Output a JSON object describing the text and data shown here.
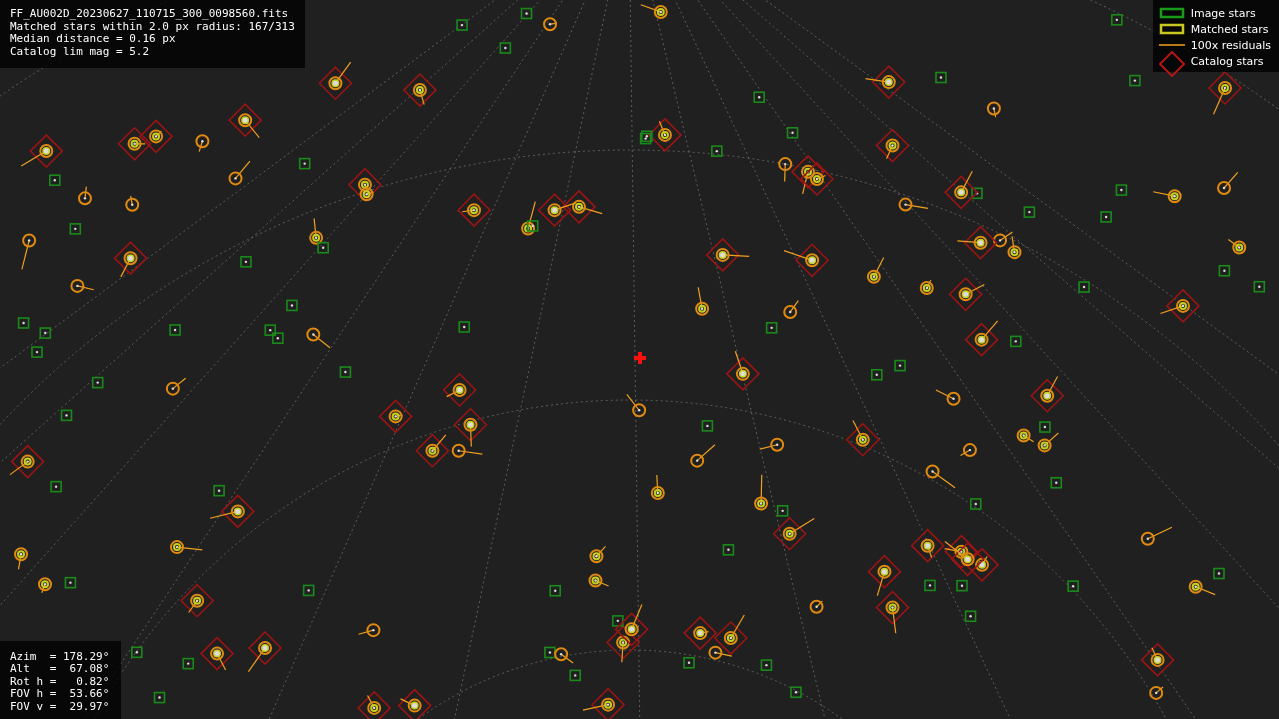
{
  "info": {
    "lines": [
      "FF_AU002D_20230627_110715_300_0098560.fits",
      "Matched stars within 2.0 px radius: 167/313",
      "Median distance = 0.16 px",
      "Catalog lim mag = 5.2"
    ]
  },
  "pointing": {
    "lines": [
      "Azim  = 178.29°",
      "Alt   =  67.08°",
      "Rot h =   0.82°",
      "FOV h =  53.66°",
      "FOV v =  29.97°"
    ]
  },
  "legend": [
    {
      "kind": "image",
      "label": "Image stars"
    },
    {
      "kind": "matched",
      "label": "Matched stars"
    },
    {
      "kind": "residual",
      "label": "100x residuals"
    },
    {
      "kind": "catalog",
      "label": "Catalog stars"
    }
  ]
}
